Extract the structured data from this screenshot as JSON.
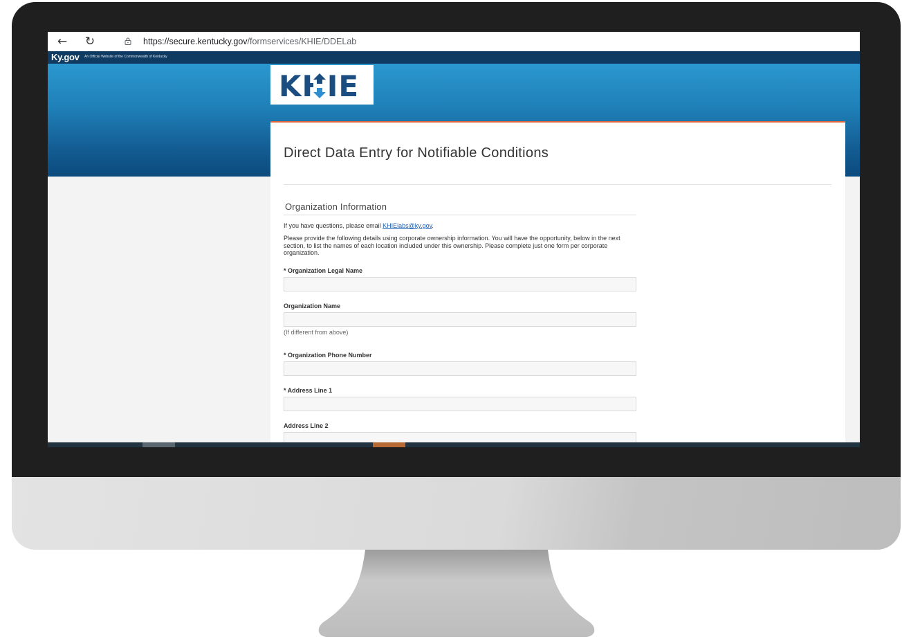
{
  "browser": {
    "url_host": "https://secure.kentucky.gov",
    "url_path": "/formservices/KHIE/DDELab"
  },
  "ky_banner": {
    "logo": "Ky.gov",
    "tagline": "An Official Website of the Commonwealth of Kentucky"
  },
  "brand": {
    "logo_text": "KHIE",
    "primary_color": "#1b4d80",
    "accent_color": "#e2683c"
  },
  "form": {
    "title": "Direct Data Entry for Notifiable Conditions",
    "section": "Organization Information",
    "intro_prefix": "If you have questions, please email ",
    "intro_email": "KHIElabs@ky.gov",
    "intro_suffix": ".",
    "intro_paragraph": "Please provide the following details using corporate ownership information. You will have the opportunity, below in the next section, to list the names of each location included under this ownership. Please complete just one form per corporate organization.",
    "fields": [
      {
        "label": "* Organization Legal Name",
        "value": ""
      },
      {
        "label": "Organization Name",
        "value": "",
        "help": "(If different from above)"
      },
      {
        "label": "* Organization Phone Number",
        "value": ""
      },
      {
        "label": "* Address Line 1",
        "value": ""
      },
      {
        "label": "Address Line 2",
        "value": ""
      }
    ]
  },
  "icons": {
    "back": "arrow-left-icon",
    "reload": "reload-icon",
    "site_info": "lock-icon"
  }
}
